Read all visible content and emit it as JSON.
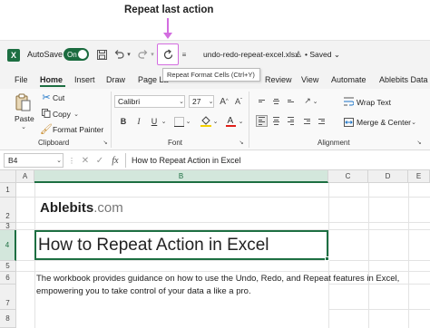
{
  "callout": {
    "label": "Repeat last action"
  },
  "titlebar": {
    "autosave_label": "AutoSave",
    "autosave_state": "On",
    "filename": "undo-redo-repeat-excel.xlsx",
    "saved_status": "Saved"
  },
  "tooltip": {
    "text": "Repeat Format Cells (Ctrl+Y)"
  },
  "menu": {
    "items": [
      "File",
      "Home",
      "Insert",
      "Draw",
      "Page La",
      "Review",
      "View",
      "Automate",
      "Ablebits Data"
    ]
  },
  "ribbon": {
    "clipboard": {
      "paste": "Paste",
      "cut": "Cut",
      "copy": "Copy",
      "format_painter": "Format Painter",
      "group": "Clipboard"
    },
    "font": {
      "name": "Calibri",
      "size": "27",
      "bold": "B",
      "italic": "I",
      "underline": "U",
      "group": "Font"
    },
    "alignment": {
      "wrap": "Wrap Text",
      "merge": "Merge & Center",
      "group": "Alignment"
    }
  },
  "formula": {
    "cell_ref": "B4",
    "fx": "fx",
    "content": "How to Repeat Action in Excel"
  },
  "sheet": {
    "columns": [
      "A",
      "B",
      "C",
      "D",
      "E"
    ],
    "rows": [
      "1",
      "2",
      "3",
      "4",
      "5",
      "6",
      "7",
      "8"
    ],
    "logo_bold": "Ablebits",
    "logo_light": ".com",
    "title": "How to Repeat Action in Excel",
    "description": "The workbook provides guidance on how to use the Undo, Redo, and Repeat features in Excel, empowering you to take control of your data a like a pro."
  },
  "colors": {
    "excel_green": "#1d6f42",
    "highlight": "#d36de0"
  }
}
